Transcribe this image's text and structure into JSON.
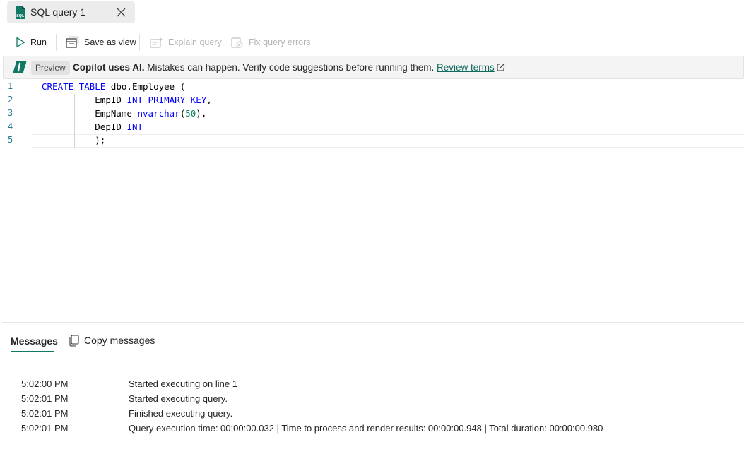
{
  "tab": {
    "title": "SQL query 1",
    "icon": "sql-file-icon",
    "close_icon": "close-icon"
  },
  "toolbar": {
    "run_label": "Run",
    "save_as_view_label": "Save as view",
    "explain_query_label": "Explain query",
    "fix_query_errors_label": "Fix query errors"
  },
  "banner": {
    "preview_label": "Preview",
    "bold_text": "Copilot uses AI.",
    "text": " Mistakes can happen. Verify code suggestions before running them. ",
    "link_label": "Review terms"
  },
  "editor": {
    "line_numbers": [
      "1",
      "2",
      "3",
      "4",
      "5"
    ],
    "lines": [
      "CREATE TABLE dbo.Employee (",
      "          EmpID INT PRIMARY KEY,",
      "          EmpName nvarchar(50),",
      "          DepID INT",
      "          );"
    ]
  },
  "messages": {
    "tab_label": "Messages",
    "copy_label": "Copy messages",
    "rows": [
      {
        "time": "5:02:00 PM",
        "text": "Started executing on line 1"
      },
      {
        "time": "5:02:01 PM",
        "text": "Started executing query."
      },
      {
        "time": "5:02:01 PM",
        "text": "Finished executing query."
      },
      {
        "time": "5:02:01 PM",
        "text": "Query execution time: 00:00:00.032 | Time to process and render results: 00:00:00.948 | Total duration: 00:00:00.980"
      }
    ]
  },
  "colors": {
    "accent": "#117865",
    "keyword": "#0000ff",
    "number": "#098658",
    "line_number": "#237893"
  }
}
